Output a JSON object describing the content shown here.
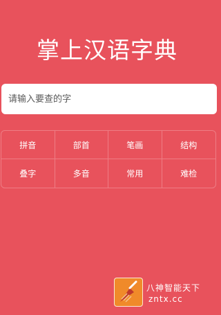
{
  "app": {
    "title": "掌上汉语字典"
  },
  "search": {
    "placeholder": "请输入要查的字"
  },
  "categories": [
    {
      "label": "拼音"
    },
    {
      "label": "部首"
    },
    {
      "label": "笔画"
    },
    {
      "label": "结构"
    },
    {
      "label": "叠字"
    },
    {
      "label": "多音"
    },
    {
      "label": "常用"
    },
    {
      "label": "难检"
    }
  ],
  "watermark": {
    "line1": "八神智能天下",
    "line2": "zntx.cc"
  },
  "colors": {
    "background": "#e8525c",
    "text": "#ffffff",
    "watermark_logo": "#f08a2a"
  }
}
